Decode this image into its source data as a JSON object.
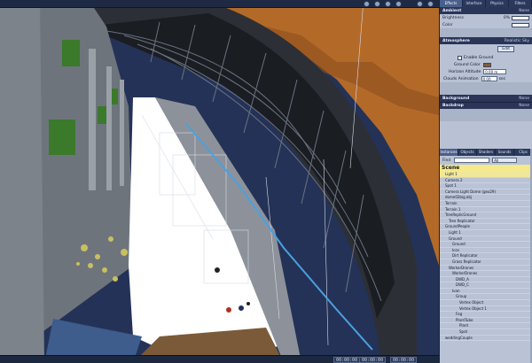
{
  "viewport": {
    "timecode_1": "00:00:00",
    "timecode_2": "00:00:00",
    "timecode_3": "00:00:00"
  },
  "panel": {
    "tabs": [
      "Effects",
      "Interface",
      "Physics",
      "Filters"
    ],
    "ambient": {
      "label": "Ambient",
      "value": "None"
    },
    "brightness": {
      "label": "Brightness",
      "value": "0%"
    },
    "color_label": "Color",
    "atmosphere": {
      "label": "Atmosphere",
      "value": "Realistic Sky"
    },
    "edit_button": "Edit",
    "enable_ground": "Enable Ground",
    "ground_color": "Ground Color",
    "horizon_altitude": {
      "label": "Horizon Altitude",
      "value": "0.00 m"
    },
    "clouds_animation": {
      "label": "Clouds Animation",
      "value": "0.00",
      "unit": "sec"
    },
    "background": {
      "label": "Background",
      "value": "None"
    },
    "backdrop": {
      "label": "Backdrop",
      "value": "None"
    }
  },
  "tree": {
    "tabs": [
      "Instances",
      "Objects",
      "Shaders",
      "Sounds",
      "Clips"
    ],
    "find_label": "Find",
    "find_value": "",
    "find_mode": "All",
    "scene_title": "Scene",
    "items": [
      "Light 1",
      "Camera 2",
      "Spot 1",
      "Camera Light Dome (geo29)",
      "dome02big.obj",
      "Terrain",
      "Terrain 1",
      "TreeReplicGround",
      "Tree Replicator",
      "GroundPeople",
      "Light 1",
      "Ground",
      "Ground",
      "Icos",
      "Dirt Replicator",
      "Grass Replicator",
      "WorkerDrones",
      "WorkerDrones",
      "DWD_A",
      "DWD_C",
      "Ivan",
      "Group",
      "Vertex Object",
      "Vertex Object 1",
      "Fog",
      "PlantTube",
      "Plant",
      "Spot",
      "weddingCouple"
    ],
    "indent": [
      1,
      1,
      1,
      1,
      1,
      1,
      1,
      1,
      2,
      1,
      2,
      2,
      3,
      3,
      3,
      3,
      2,
      3,
      4,
      4,
      3,
      4,
      5,
      5,
      4,
      4,
      5,
      5,
      1
    ]
  },
  "colors": {
    "sky": "#2a3a6a",
    "terrain": "#b06a2a",
    "dome_frame": "#5a6068",
    "floor": "#ffffff",
    "panel_header": "#2a3558",
    "scene_highlight": "#f4ea8c"
  }
}
